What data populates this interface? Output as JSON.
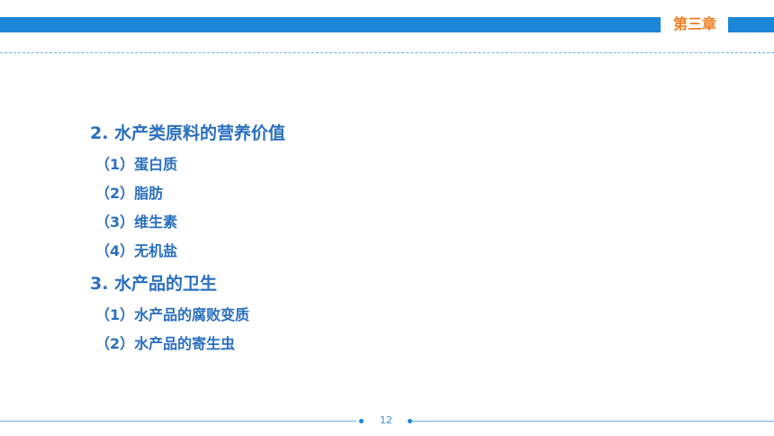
{
  "header": {
    "chapter_label": "第三章"
  },
  "content": {
    "section2": {
      "title": "2. 水产类原料的营养价值",
      "items": [
        "（1）蛋白质",
        "（2）脂肪",
        "（3）维生素",
        "（4）无机盐"
      ]
    },
    "section3": {
      "title": "3. 水产品的卫生",
      "items": [
        "（1）水产品的腐败变质",
        "（2）水产品的寄生虫"
      ]
    }
  },
  "footer": {
    "page_number": "12"
  },
  "colors": {
    "bar_blue": "#1b86d6",
    "text_blue": "#2a6fc0",
    "chapter_orange": "#f07d1f"
  }
}
